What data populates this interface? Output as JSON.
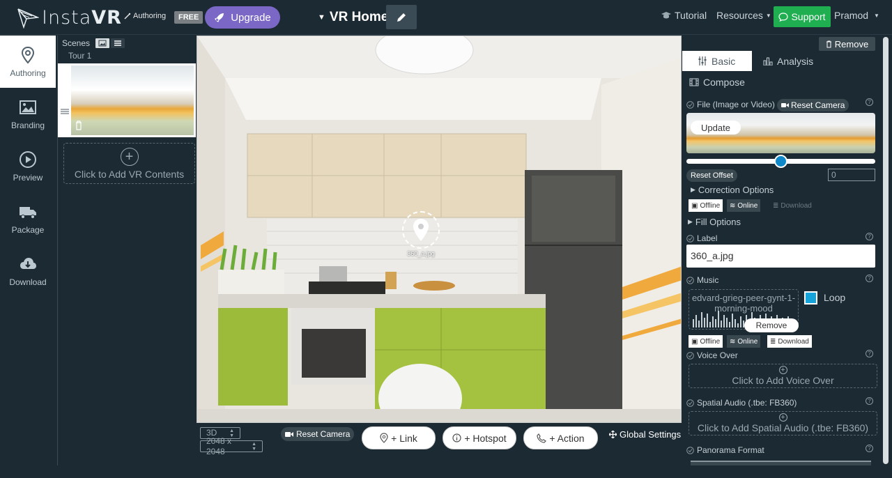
{
  "topbar": {
    "logo_text_light": "Insta",
    "logo_text_bold": "VR",
    "authoring_tag": "Authoring",
    "free_badge": "FREE",
    "upgrade_label": "Upgrade",
    "scene_title": "VR Home",
    "tutorial": "Tutorial",
    "resources": "Resources",
    "support": "Support",
    "user": "Pramod"
  },
  "leftnav": {
    "items": [
      {
        "label": "Authoring",
        "icon": "map-pin-icon"
      },
      {
        "label": "Branding",
        "icon": "image-icon"
      },
      {
        "label": "Preview",
        "icon": "play-circle-icon"
      },
      {
        "label": "Package",
        "icon": "truck-icon"
      },
      {
        "label": "Download",
        "icon": "cloud-download-icon"
      }
    ]
  },
  "scenes": {
    "header": "Scenes",
    "tour": "Tour 1",
    "add_contents": "Click to Add VR Contents"
  },
  "viewer": {
    "hotspot_label": "360_a.jpg"
  },
  "bottombar": {
    "mode": "3D",
    "resolution": "2048 x 2048",
    "reset_camera": "Reset Camera",
    "link": "+ Link",
    "hotspot": "+ Hotspot",
    "action": "+ Action",
    "global_settings": "Global Settings"
  },
  "right": {
    "remove": "Remove",
    "tabs": {
      "basic": "Basic",
      "analysis": "Analysis",
      "compose": "Compose"
    },
    "file_label": "File (Image or Video)",
    "reset_camera": "Reset Camera",
    "update": "Update",
    "slider_value": 0.5,
    "reset_offset": "Reset Offset",
    "offset_value": "0",
    "correction_options": "Correction Options",
    "offline": "Offline",
    "online": "Online",
    "download": "Download",
    "fill_options": "Fill Options",
    "label_title": "Label",
    "label_value": "360_a.jpg",
    "music_title": "Music",
    "music_file": "edvard-grieg-peer-gynt-1-morning-mood",
    "music_remove": "Remove",
    "loop": "Loop",
    "voice_over": "Voice Over",
    "add_voice_over": "Click to Add Voice Over",
    "spatial_audio": "Spatial Audio (.tbe: FB360)",
    "add_spatial_audio": "Click to Add Spatial Audio (.tbe: FB360)",
    "panorama_format": "Panorama Format"
  },
  "colors": {
    "background": "#1c2a33",
    "upgrade": "#7b68c6",
    "support": "#1fae50",
    "accent": "#0e88c8"
  }
}
